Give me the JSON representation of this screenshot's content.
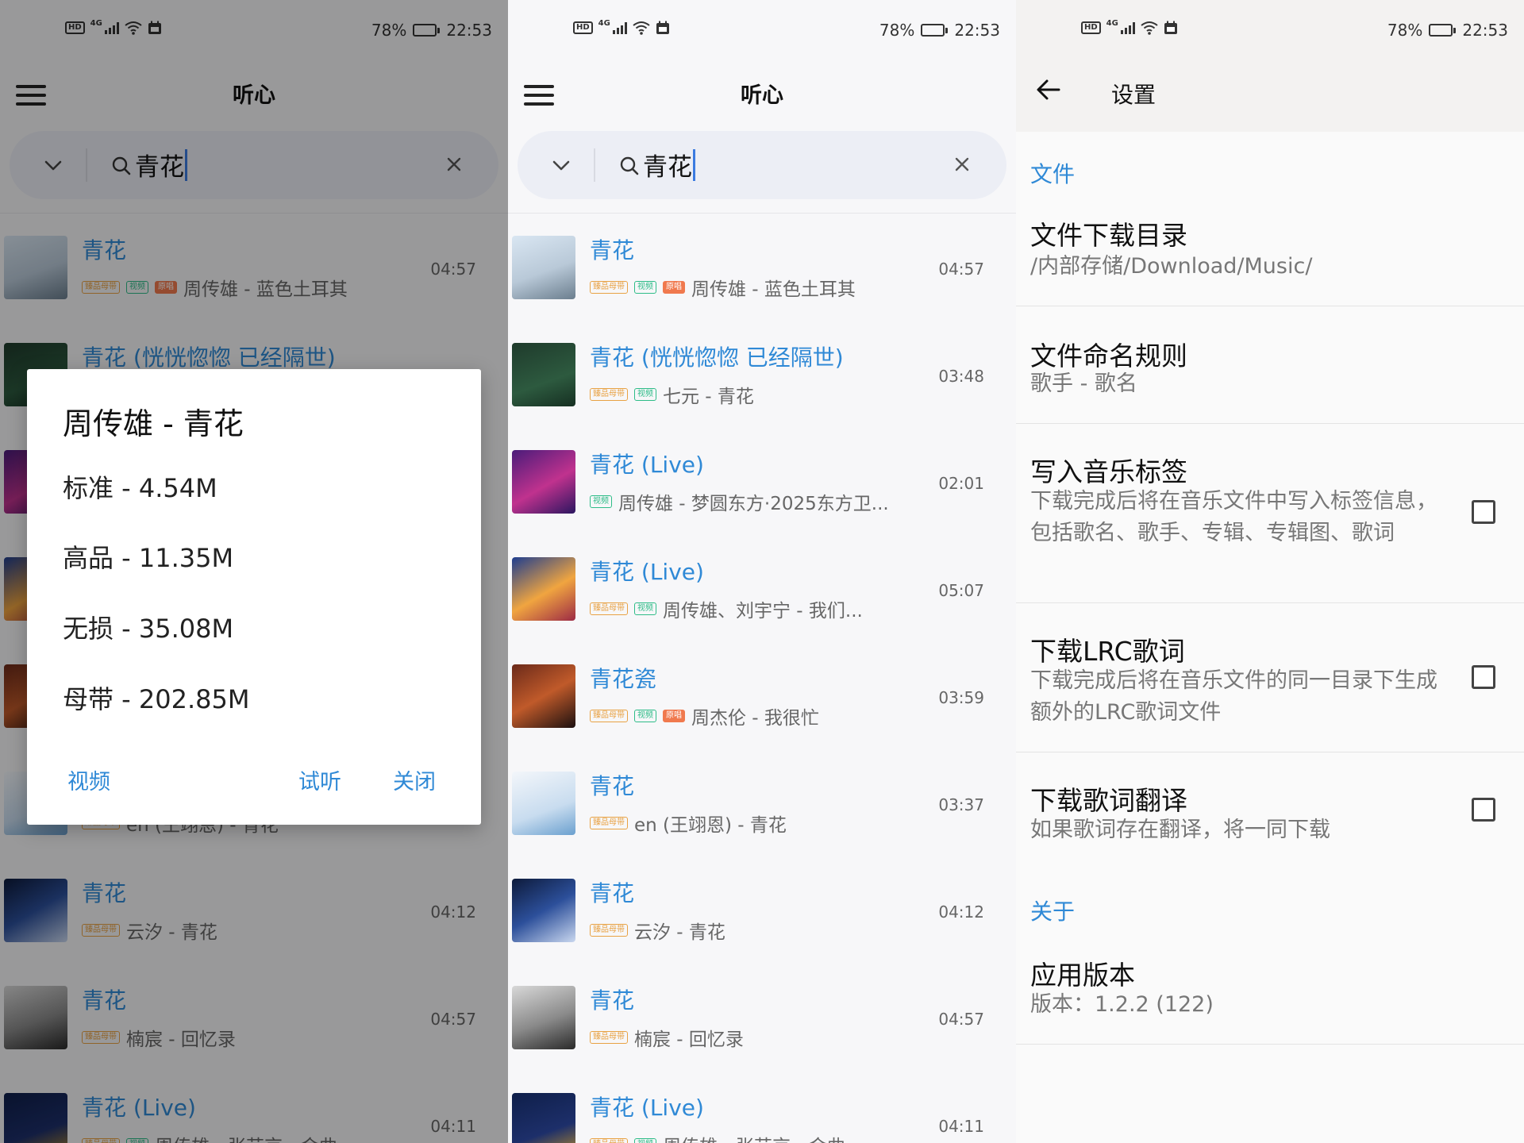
{
  "status_bar": {
    "battery": "78%",
    "time": "22:53",
    "network": "4G",
    "battery_level": 0.78
  },
  "app": {
    "title": "听心"
  },
  "search": {
    "query": "青花"
  },
  "songs": [
    {
      "title": "青花",
      "tags": [
        "臻品母带",
        "视频",
        "原唱"
      ],
      "subtitle": "周传雄 - 蓝色土耳其",
      "duration": "04:57"
    },
    {
      "title": "青花 (恍恍惚惚 已经隔世)",
      "tags": [
        "臻品母带",
        "视频"
      ],
      "subtitle": "七元 - 青花",
      "duration": "03:48"
    },
    {
      "title": "青花 (Live)",
      "tags": [
        "视频"
      ],
      "subtitle": "周传雄 - 梦圆东方·2025东方卫...",
      "duration": "02:01"
    },
    {
      "title": "青花 (Live)",
      "tags": [
        "臻品母带",
        "视频"
      ],
      "subtitle": "周传雄、刘宇宁 - 我们...",
      "duration": "05:07"
    },
    {
      "title": "青花瓷",
      "tags": [
        "臻品母带",
        "视频",
        "原唱"
      ],
      "subtitle": "周杰伦 - 我很忙",
      "duration": "03:59"
    },
    {
      "title": "青花",
      "tags": [
        "臻品母带"
      ],
      "subtitle": "en (王翊恩) - 青花",
      "duration": "03:37"
    },
    {
      "title": "青花",
      "tags": [
        "臻品母带"
      ],
      "subtitle": "云汐 - 青花",
      "duration": "04:12"
    },
    {
      "title": "青花",
      "tags": [
        "臻品母带"
      ],
      "subtitle": "楠宸 - 回忆录",
      "duration": "04:57"
    },
    {
      "title": "青花 (Live)",
      "tags": [
        "臻品母带",
        "视频"
      ],
      "subtitle": "周传雄、张芸京 - 金曲",
      "duration": "04:11"
    }
  ],
  "dialog": {
    "title": "周传雄 - 青花",
    "options": [
      "标准 - 4.54M",
      "高品 - 11.35M",
      "无损 - 35.08M",
      "母带 - 202.85M"
    ],
    "buttons": {
      "video": "视频",
      "preview": "试听",
      "close": "关闭"
    }
  },
  "settings": {
    "title": "设置",
    "section_file": "文件",
    "items": [
      {
        "title": "文件下载目录",
        "subtitle": "/内部存储/Download/Music/"
      },
      {
        "title": "文件命名规则",
        "subtitle": "歌手 - 歌名"
      },
      {
        "title": "写入音乐标签",
        "subtitle": "下载完成后将在音乐文件中写入标签信息，包括歌名、歌手、专辑、专辑图、歌词",
        "checked": false
      },
      {
        "title": "下载LRC歌词",
        "subtitle": "下载完成后将在音乐文件的同一目录下生成额外的LRC歌词文件",
        "checked": false
      },
      {
        "title": "下载歌词翻译",
        "subtitle": "如果歌词存在翻译，将一同下载",
        "checked": false
      }
    ],
    "section_about": "关于",
    "about": {
      "title": "应用版本",
      "subtitle": "版本：1.2.2 (122)"
    }
  },
  "colors": {
    "accent": "#2f89d6",
    "tag_master": "#e8a244",
    "tag_video": "#2ebc88",
    "tag_original": "#f0794e"
  }
}
